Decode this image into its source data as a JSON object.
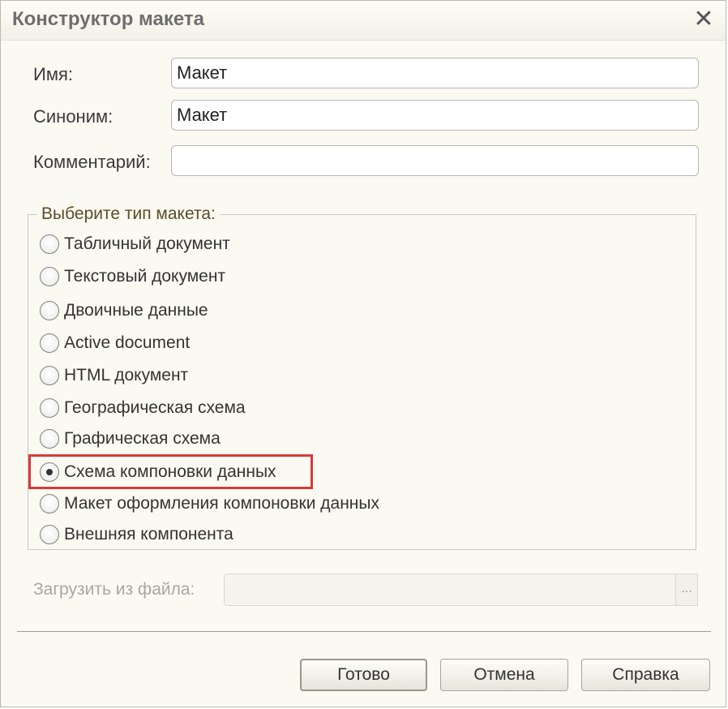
{
  "window": {
    "title": "Конструктор макета",
    "close_icon": "close-icon"
  },
  "form": {
    "name_label": "Имя:",
    "name_value": "Макет",
    "synonym_label": "Синоним:",
    "synonym_value": "Макет",
    "comment_label": "Комментарий:",
    "comment_value": ""
  },
  "layout_type": {
    "group_title": "Выберите тип макета:",
    "options": [
      {
        "label": "Табличный документ",
        "checked": false
      },
      {
        "label": "Текстовый документ",
        "checked": false
      },
      {
        "label": "Двоичные данные",
        "checked": false
      },
      {
        "label": "Active document",
        "checked": false
      },
      {
        "label": "HTML документ",
        "checked": false
      },
      {
        "label": "Географическая схема",
        "checked": false
      },
      {
        "label": "Графическая схема",
        "checked": false
      },
      {
        "label": "Схема компоновки данных",
        "checked": true
      },
      {
        "label": "Макет оформления компоновки данных",
        "checked": false
      },
      {
        "label": "Внешняя компонента",
        "checked": false
      }
    ],
    "highlight_color": "#d83a3a"
  },
  "file": {
    "label": "Загрузить из файла:",
    "value": "",
    "browse_label": "..."
  },
  "buttons": {
    "ok": "Готово",
    "cancel": "Отмена",
    "help": "Справка"
  }
}
